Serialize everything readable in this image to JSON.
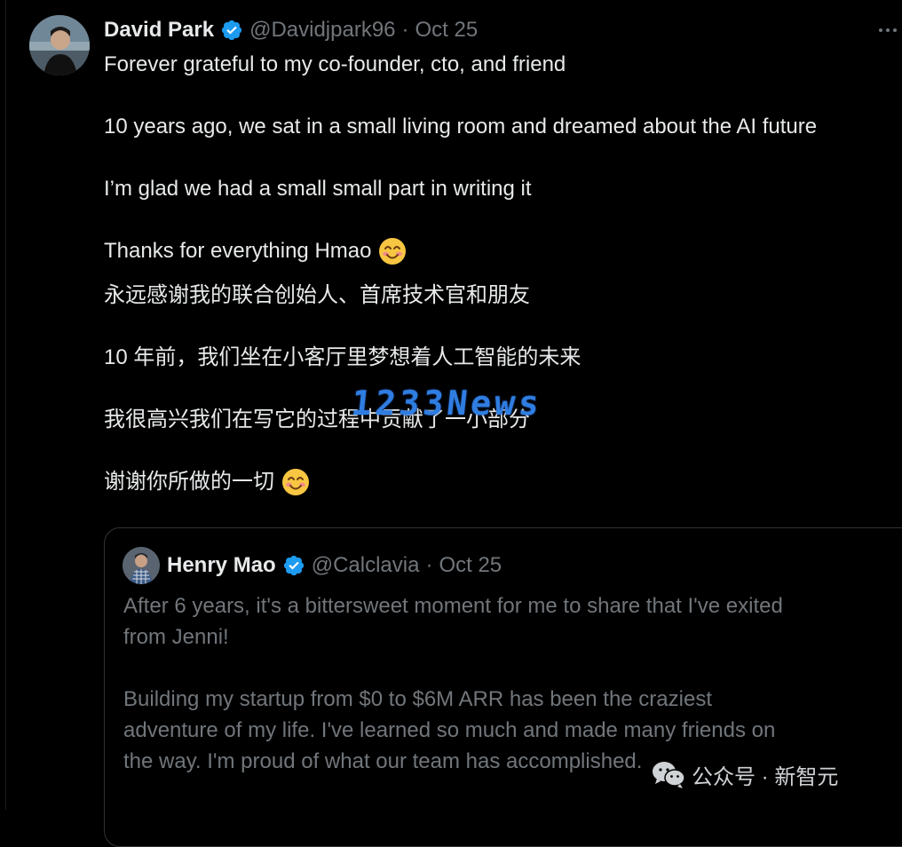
{
  "tweet": {
    "author": {
      "name": "David Park",
      "handle": "@Davidjpark96",
      "separator": "·",
      "date": "Oct 25"
    },
    "lines": [
      "Forever grateful to my co-founder, cto, and friend",
      "10 years ago, we sat in a small living room and dreamed about the AI future",
      "I’m glad we had a small small part in writing it",
      "Thanks for everything Hmao",
      "永远感谢我的联合创始人、首席技术官和朋友",
      "10 年前，我们坐在小客厅里梦想着人工智能的未来",
      "我很高兴我们在写它的过程中贡献了一小部分",
      "谢谢你所做的一切"
    ]
  },
  "quoted_tweet": {
    "author": {
      "name": "Henry Mao",
      "handle": "@Calclavia",
      "separator": "·",
      "date": "Oct 25"
    },
    "lines": [
      "After 6 years, it's a bittersweet moment for me to share that I've exited",
      "from Jenni!",
      "Building my startup from $0 to $6M ARR has been the craziest",
      "adventure of my life. I've learned so much and made many friends on",
      "the way. I'm proud of what our team has accomplished."
    ]
  },
  "overlays": {
    "watermark_center": "1233News",
    "wechat_label": "公众号 · 新智元"
  },
  "icons": {
    "verified": "verified-badge-icon",
    "more": "more-horizontal-icon",
    "emoji": "smiling-face-with-smiling-eyes-emoji",
    "wechat": "wechat-icon"
  },
  "colors": {
    "background": "#000000",
    "text_primary": "#e7e9ea",
    "text_secondary": "#71767b",
    "verified_blue": "#1d9bf0",
    "border": "#2f3336",
    "watermark": "#2f7de1"
  }
}
